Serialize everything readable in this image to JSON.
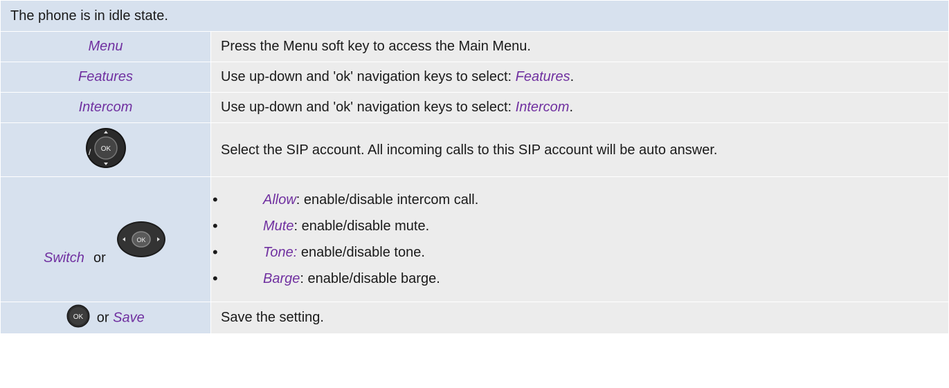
{
  "header": "The phone is in idle state.",
  "rows": [
    {
      "left": "Menu",
      "right": "Press the Menu soft key to access the Main Menu."
    },
    {
      "left": "Features",
      "right_prefix": "Use up-down and 'ok' navigation keys to select: ",
      "right_link": "Features",
      "right_suffix": "."
    },
    {
      "left": "Intercom",
      "right_prefix": "Use up-down and 'ok' navigation keys to select: ",
      "right_link": "Intercom",
      "right_suffix": "."
    },
    {
      "left_icon": "navigation-up-down-ok-icon",
      "right": "Select the SIP account. All incoming calls to this SIP account will be auto answer."
    },
    {
      "left_text": "Switch",
      "left_or": "or",
      "left_icon": "navigation-left-right-ok-icon",
      "bullets": [
        {
          "term": "Allow",
          "rest": ": enable/disable intercom call."
        },
        {
          "term": "Mute",
          "rest": ": enable/disable mute."
        },
        {
          "term": "Tone:",
          "rest": " enable/disable tone."
        },
        {
          "term": "Barge",
          "rest": ": enable/disable barge."
        }
      ]
    },
    {
      "left_icon": "ok-key-icon",
      "left_or": "or",
      "left_text": "Save",
      "right": "Save the setting."
    }
  ],
  "icon_labels": {
    "ok": "OK",
    "slash": "/"
  },
  "colors": {
    "header_bg": "#d7e1ee",
    "row_bg": "#ececec",
    "accent": "#7030a0"
  }
}
